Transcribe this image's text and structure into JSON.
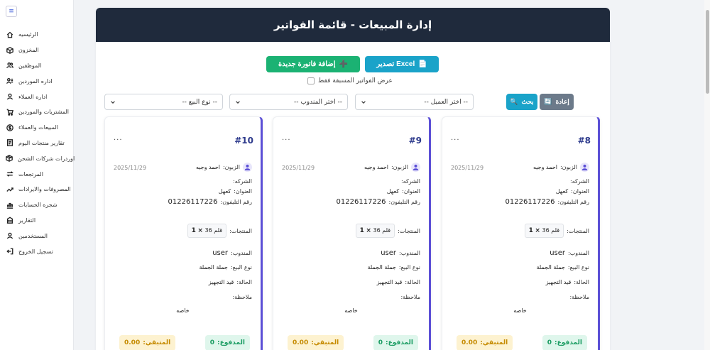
{
  "sidebar": {
    "toggle_icon": "≡",
    "items": [
      {
        "label": "الرئيسيه",
        "icon": "home-icon"
      },
      {
        "label": "المخزون",
        "icon": "box-icon"
      },
      {
        "label": "الموظفين",
        "icon": "users-icon"
      },
      {
        "label": "اداره الموردين",
        "icon": "suppliers-icon"
      },
      {
        "label": "اداره العملاء",
        "icon": "user-icon"
      },
      {
        "label": "المشتريات والموردين",
        "icon": "cart-icon"
      },
      {
        "label": "المبيعات والعملاء",
        "icon": "dollar-icon"
      },
      {
        "label": "تقارير منتجات اليوم",
        "icon": "report-icon"
      },
      {
        "label": "اوردرات شركات الشحن",
        "icon": "shipping-box-icon"
      },
      {
        "label": "المرتجعات",
        "icon": "return-arrows-icon"
      },
      {
        "label": "المصروفات والايرادات",
        "icon": "trend-icon"
      },
      {
        "label": "شجره الحسابات",
        "icon": "accounts-tree-icon"
      },
      {
        "label": "التقارير",
        "icon": "building-icon"
      },
      {
        "label": "المستخدمين",
        "icon": "account-icon"
      },
      {
        "label": "تسجيل الخروج",
        "icon": "logout-icon"
      }
    ]
  },
  "header": {
    "title": "إدارة المبيعات - قائمة الفواتير"
  },
  "actions": {
    "excel_label": "Excel تصدير",
    "add_label": "إضافة فاتورة جديدة",
    "prev_only_label": "عرض الفواتير المسبقة فقط"
  },
  "filters": {
    "customer_placeholder": "-- اختر العميل --",
    "rep_placeholder": "-- اختر المندوب --",
    "sale_type_placeholder": "-- نوع البيع --",
    "search_label": "بحث",
    "reset_label": "إعادة"
  },
  "labels": {
    "customer": "الزبون:",
    "company": "الشركه:",
    "address": "العنوان:",
    "phone": "رقم التليفون:",
    "products": "المنتجات:",
    "rep": "المندوب:",
    "sale_type": "نوع البيع:",
    "status": "الحالة:",
    "notes": "ملاحظة:",
    "paid": "المدفوع:",
    "remaining": "المتبقي:"
  },
  "invoices": [
    {
      "number": "#8",
      "customer": "احمد وجيه",
      "date": "2025/11/29",
      "address": "كعهل",
      "phone": "01226117226",
      "product_name": "قلم",
      "product_size": "36",
      "product_qty": "1",
      "rep": "user",
      "sale_type": "جملة الجملة",
      "status": "قيد التجهيز",
      "note": "خاصه",
      "paid": "0",
      "remaining": "0.00"
    },
    {
      "number": "#9",
      "customer": "احمد وجيه",
      "date": "2025/11/29",
      "address": "كعهل",
      "phone": "01226117226",
      "product_name": "قلم",
      "product_size": "36",
      "product_qty": "1",
      "rep": "user",
      "sale_type": "جملة الجملة",
      "status": "قيد التجهيز",
      "note": "خاصه",
      "paid": "0",
      "remaining": "0.00"
    },
    {
      "number": "#10",
      "customer": "احمد وجيه",
      "date": "2025/11/29",
      "address": "كعهل",
      "phone": "01226117226",
      "product_name": "قلم",
      "product_size": "36",
      "product_qty": "1",
      "rep": "user",
      "sale_type": "جملة الجملة",
      "status": "قيد التجهيز",
      "note": "خاصه",
      "paid": "0",
      "remaining": "0.00"
    }
  ],
  "colors": {
    "header_bg": "#1f2a3c",
    "excel": "#1aa3c9",
    "add": "#1bb273",
    "accent": "#5b4fd6"
  }
}
